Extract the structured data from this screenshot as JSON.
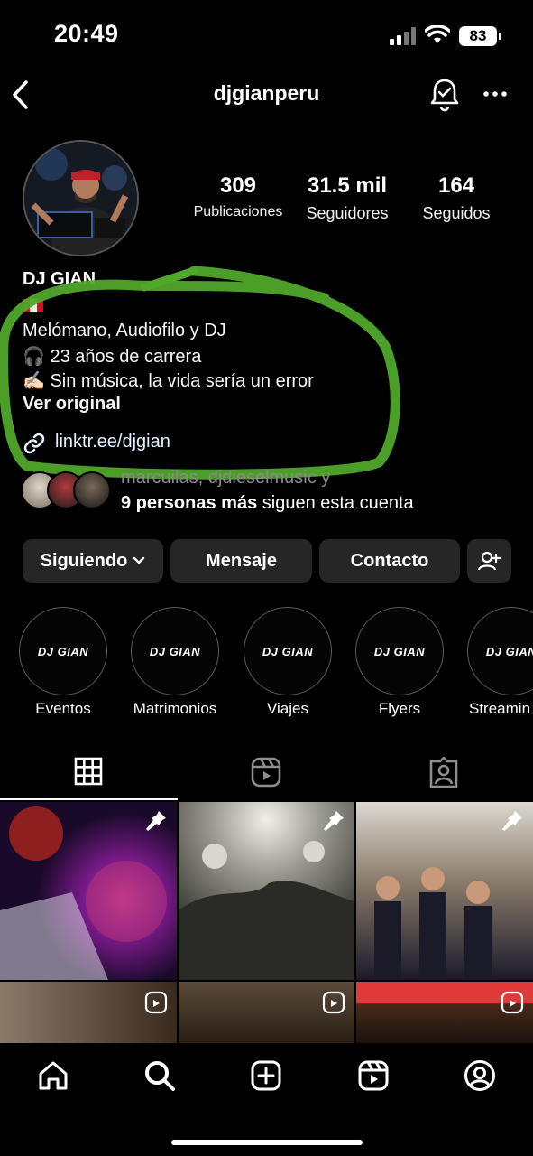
{
  "status_bar": {
    "time": "20:49",
    "battery": "83"
  },
  "header": {
    "username": "djgianperu"
  },
  "profile": {
    "display_name": "DJ GIAN",
    "stats": [
      {
        "value": "309",
        "label": "Publicaciones"
      },
      {
        "value": "31.5 mil",
        "label": "Seguidores"
      },
      {
        "value": "164",
        "label": "Seguidos"
      }
    ],
    "bio_lines": [
      "Melómano, Audiofilo y DJ",
      "🎧 23 años de carrera",
      "✍🏻 Sin música, la vida sería un error"
    ],
    "see_original": "Ver original",
    "link": "linktr.ee/djgian",
    "mutual_names": "marcuilas, djdieselmusic y",
    "mutual_more_bold": "9 personas más",
    "mutual_more_rest": " siguen esta cuenta"
  },
  "actions": {
    "following": "Siguiendo",
    "message": "Mensaje",
    "contact": "Contacto"
  },
  "highlights": [
    {
      "label": "Eventos",
      "logo": "DJ GIAN"
    },
    {
      "label": "Matrimonios",
      "logo": "DJ GIAN"
    },
    {
      "label": "Viajes",
      "logo": "DJ GIAN"
    },
    {
      "label": "Flyers",
      "logo": "DJ GIAN"
    },
    {
      "label": "Streamin",
      "logo": "DJ GIAN"
    }
  ],
  "colors": {
    "accent_highlight": "#4fa82a",
    "button_bg": "#262626",
    "background": "#000000"
  },
  "icons": [
    "back-icon",
    "bell-check-icon",
    "more-icon",
    "link-icon",
    "chevron-down-icon",
    "add-person-icon",
    "grid-icon",
    "reels-icon",
    "tagged-icon",
    "pin-icon",
    "home-icon",
    "search-icon",
    "create-icon",
    "reels-nav-icon",
    "profile-icon"
  ]
}
